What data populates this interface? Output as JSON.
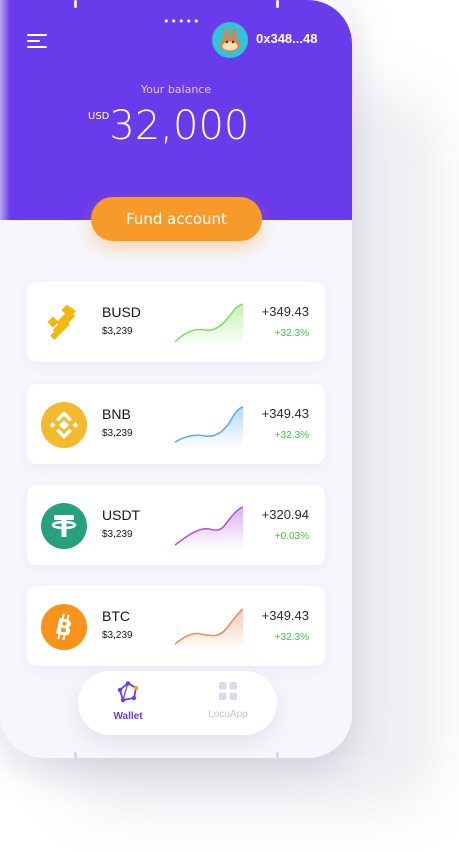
{
  "header": {
    "address": "0x348...48",
    "balance_label": "Your balance",
    "balance_currency": "USD",
    "balance_value": "32,000",
    "fund_button": "Fund account",
    "dots": "•••••"
  },
  "colors": {
    "primary": "#6a3bea",
    "accent": "#f79a2a",
    "positive": "#3ec23e"
  },
  "assets": [
    {
      "symbol": "BUSD",
      "value": "$3,239",
      "change": "+349.43",
      "pct": "+32.3%",
      "icon": "busd-icon",
      "color": "#f0b90b",
      "spark": "#7ddf58"
    },
    {
      "symbol": "BNB",
      "value": "$3,239",
      "change": "+349.43",
      "pct": "+32.3%",
      "icon": "bnb-icon",
      "color": "#f3ba2f",
      "spark": "#5aa9f0"
    },
    {
      "symbol": "USDT",
      "value": "$3,239",
      "change": "+320.94",
      "pct": "+0.03%",
      "icon": "usdt-icon",
      "color": "#26a17b",
      "spark": "#b24ddc"
    },
    {
      "symbol": "BTC",
      "value": "$3,239",
      "change": "+349.43",
      "pct": "+32.3%",
      "icon": "btc-icon",
      "color": "#f7931a",
      "spark": "#ef8a5a"
    }
  ],
  "nav": {
    "wallet": "Wallet",
    "locuapp": "LocuApp"
  }
}
